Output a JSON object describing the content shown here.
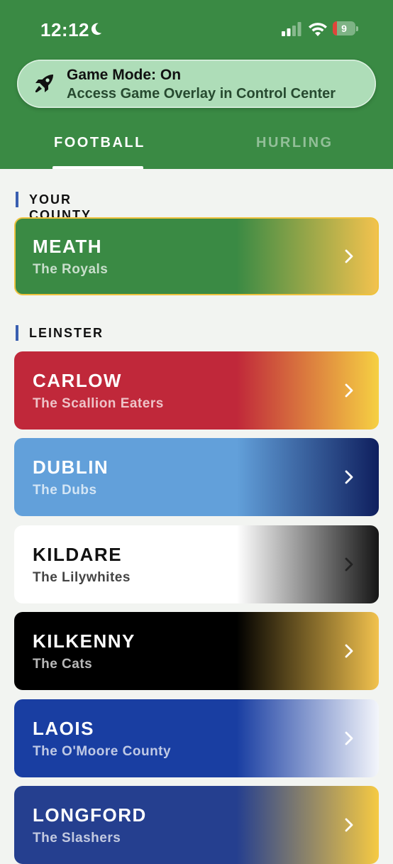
{
  "status_bar": {
    "time": "12:12",
    "battery_level": "9"
  },
  "banner": {
    "title": "Game Mode: On",
    "subtitle": "Access Game Overlay in Control Center"
  },
  "tabs": [
    {
      "label": "FOOTBALL",
      "active": true
    },
    {
      "label": "HURLING",
      "active": false
    }
  ],
  "sections": {
    "your_county": "YOUR COUNTY",
    "leinster": "LEINSTER"
  },
  "your_county": {
    "name": "MEATH",
    "nickname": "The Royals",
    "colors": [
      "#3a8a44",
      "#f2c24e"
    ],
    "border": "#efc23e"
  },
  "counties": [
    {
      "name": "CARLOW",
      "nickname": "The Scallion Eaters",
      "colors": [
        "#c0283a",
        "#f6d043"
      ]
    },
    {
      "name": "DUBLIN",
      "nickname": "The Dubs",
      "colors": [
        "#62a0da",
        "#0f1f5e"
      ]
    },
    {
      "name": "KILDARE",
      "nickname": "The Lilywhites",
      "colors": [
        "#ffffff",
        "#151515"
      ]
    },
    {
      "name": "KILKENNY",
      "nickname": "The Cats",
      "colors": [
        "#000000",
        "#f2c24e"
      ]
    },
    {
      "name": "LAOIS",
      "nickname": "The O'Moore County",
      "colors": [
        "#193ea2",
        "#f3f5fb"
      ]
    },
    {
      "name": "LONGFORD",
      "nickname": "The Slashers",
      "colors": [
        "#253f8f",
        "#f6ca43"
      ]
    }
  ],
  "icons": {
    "moon": "moon-icon",
    "signal": "cellular-signal-icon",
    "wifi": "wifi-icon",
    "battery": "battery-icon",
    "rocket": "rocket-icon",
    "chevron": "chevron-right-icon"
  }
}
